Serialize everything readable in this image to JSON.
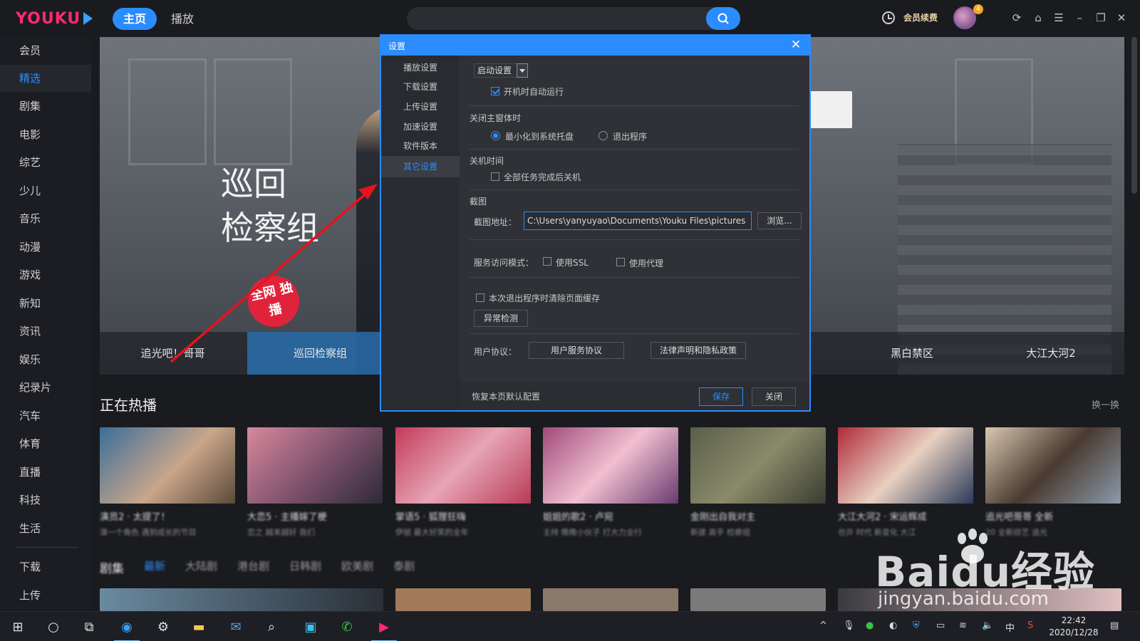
{
  "app": {
    "logo": "YOUKU",
    "nav": {
      "home": "主页",
      "play": "播放"
    },
    "vip": "会员续费",
    "avatar_badge": "4"
  },
  "sidebar": {
    "items": [
      "会员",
      "精选",
      "剧集",
      "电影",
      "综艺",
      "少儿",
      "音乐",
      "动漫",
      "游戏",
      "新知",
      "资讯",
      "娱乐",
      "纪录片",
      "汽车",
      "体育",
      "直播",
      "科技",
      "生活"
    ],
    "active_index": 1,
    "bottom": [
      "下载",
      "上传"
    ]
  },
  "banner": {
    "title_line1": "巡回",
    "title_line2": "检察组",
    "stamp": "全网 独播",
    "thumbs": [
      "追光吧！哥哥",
      "巡回检察组",
      "黑白禁区",
      "大江大河2"
    ],
    "active_thumb": 1
  },
  "hot": {
    "title": "正在热播",
    "refresh": "换一换",
    "cards": [
      {
        "title": "演员2 · 太提了！",
        "sub": "演一个角色 遇到成长的节目"
      },
      {
        "title": "大恋5 · 主播嫁了梗",
        "sub": "恋之 越来越好 我们"
      },
      {
        "title": "掌语5 · 狐狸狂嗨",
        "sub": "伊丽 最大好笑的全年"
      },
      {
        "title": "姐姐的歌2 · 卢宛",
        "sub": "主持 晚晚小伙子 打大力全行"
      },
      {
        "title": "金刚出自我对主",
        "sub": "新建 高手 检察组"
      },
      {
        "title": "大江大河2 · 宋运辉成",
        "sub": "也许 时代 新变化 大江"
      },
      {
        "title": "追光吧哥哥 全新",
        "sub": "20 全新综艺 追光"
      }
    ]
  },
  "section_tabs": [
    "剧集",
    "最新",
    "大陆剧",
    "港台剧",
    "日韩剧",
    "欧美剧",
    "泰剧"
  ],
  "dialog": {
    "title": "设置",
    "side_items": [
      "播放设置",
      "下载设置",
      "上传设置",
      "加速设置",
      "软件版本",
      "其它设置"
    ],
    "active_side_index": 5,
    "startup_select": "启动设置",
    "autorun_label": "开机时自动运行",
    "autorun_checked": true,
    "close_window_heading": "关闭主窗体时",
    "minimize_label": "最小化到系统托盘",
    "exit_label": "退出程序",
    "close_option_selected": "minimize",
    "shutdown_heading": "关机时间",
    "shutdown_label": "全部任务完成后关机",
    "shutdown_checked": false,
    "screenshot_heading": "截图",
    "screenshot_path_label": "截图地址：",
    "screenshot_path": "C:\\Users\\yanyuyao\\Documents\\Youku Files\\pictures",
    "browse": "浏览...",
    "service_mode_label": "服务访问模式：",
    "ssl_label": "使用SSL",
    "ssl_checked": false,
    "proxy_label": "使用代理",
    "proxy_checked": false,
    "clear_cache_label": "本次退出程序时清除页面缓存",
    "clear_cache_checked": false,
    "anomaly_btn": "异常检测",
    "agreement_label": "用户协议：",
    "user_service_btn": "用户服务协议",
    "legal_btn": "法律声明和隐私政策",
    "restore_defaults": "恢复本页默认配置",
    "save_btn": "保存",
    "close_btn": "关闭"
  },
  "taskbar": {
    "time": "22:42",
    "date": "2020/12/28",
    "ime": "中"
  },
  "watermark": {
    "big": "Baidu经验",
    "small": "jingyan.baidu.com"
  },
  "colors": {
    "accent": "#2b8cff",
    "logo": "#ff2a6d",
    "background": "#1a1b1f"
  }
}
